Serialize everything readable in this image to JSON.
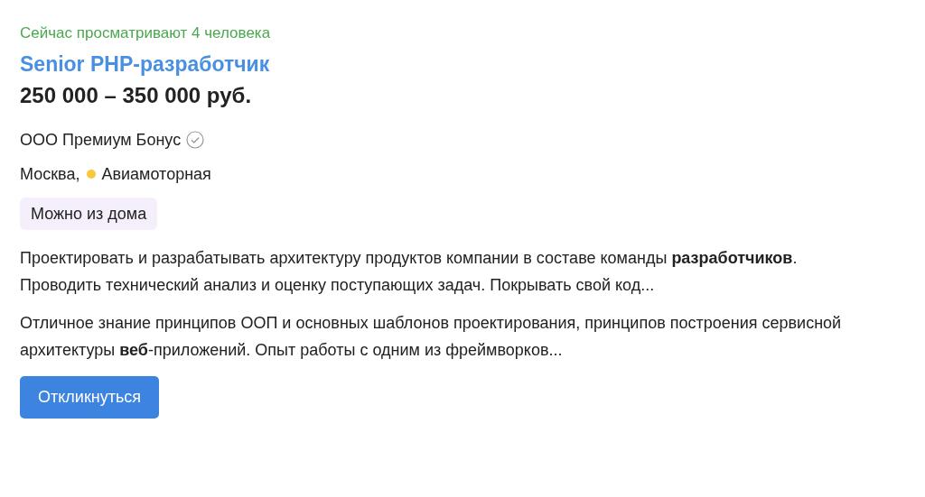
{
  "viewers": "Сейчас просматривают 4 человека",
  "title": "Senior PHP-разработчик",
  "salary": "250 000 – 350 000 руб.",
  "company": {
    "name": "ООО Премиум Бонус",
    "verified": true
  },
  "location": {
    "city": "Москва,",
    "metro": {
      "name": "Авиамоторная",
      "color": "#f7c83a"
    }
  },
  "tags": [
    "Можно из дома"
  ],
  "snippets": [
    "Проектировать и разрабатывать архитектуру продуктов компании в составе команды **разработчиков**. Проводить технический анализ и оценку поступающих задач. Покрывать свой код...",
    "Отличное знание принципов ООП и основных шаблонов проектирования, принципов построения сервисной архитектуры **веб**-приложений. Опыт работы с одним из фреймворков..."
  ],
  "button": "Откликнуться"
}
